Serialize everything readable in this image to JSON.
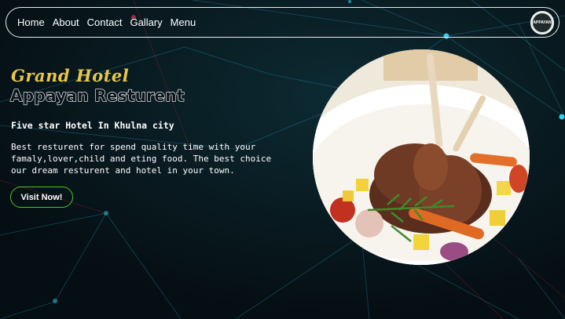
{
  "nav": {
    "links": [
      "Home",
      "About",
      "Contact",
      "Gallary",
      "Menu"
    ],
    "logo_text": "APPAYAN"
  },
  "hero": {
    "brand_small": "Grand Hotel",
    "brand_big": "Appayan Resturent",
    "subtitle": "Five star Hotel In Khulna city",
    "description": "Best resturent for spend quality time with your famaly,lover,child and eting food. The best choice our dream resturent and hotel in your town.",
    "cta_label": "Visit Now!"
  },
  "colors": {
    "background": "#06141a",
    "accent_gold": "#e8c84a",
    "cta_border": "#49c52e",
    "network_line": "#2aa9c9"
  },
  "image": {
    "icon": "food-plate-image"
  }
}
